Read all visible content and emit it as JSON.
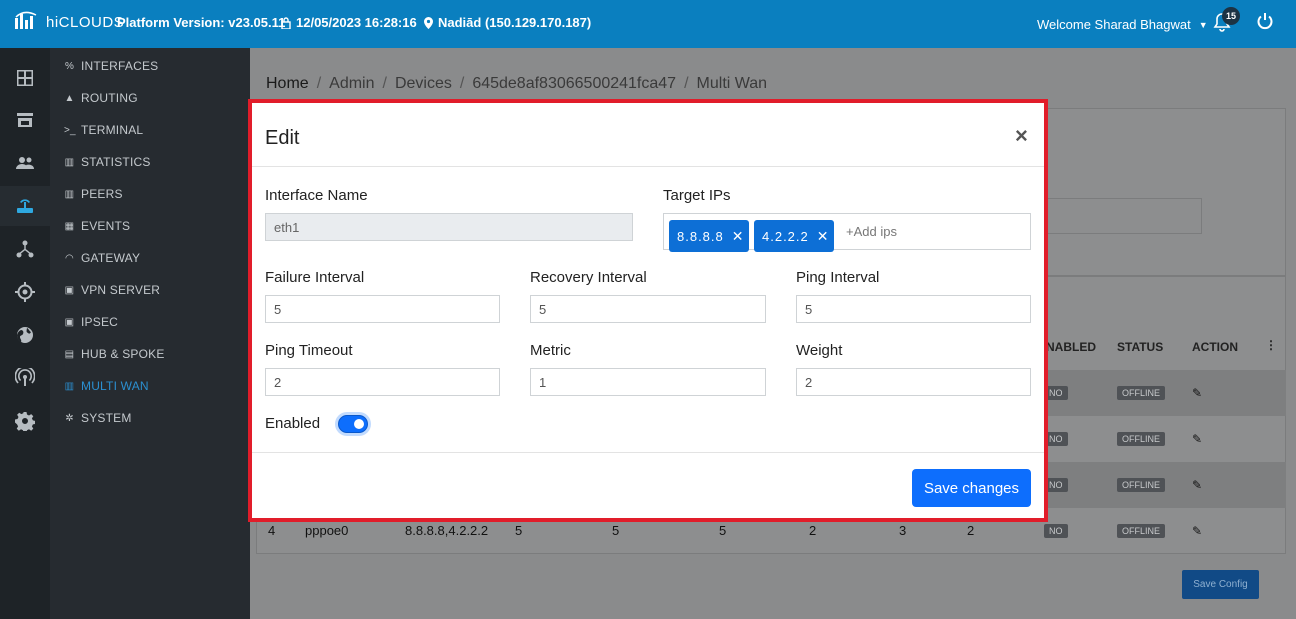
{
  "header": {
    "logo_text": "hiCLOUDS",
    "platform_version": "Platform Version: v23.05.11",
    "datetime": "12/05/2023 16:28:16",
    "location": "Nadiād (150.129.170.187)",
    "welcome": "Welcome Sharad Bhagwat",
    "notification_count": "15"
  },
  "rail_icons": [
    "grid-icon",
    "store-icon",
    "users-icon",
    "router-icon",
    "network-icon",
    "target-icon",
    "globe-icon",
    "signal-icon",
    "gear-icon"
  ],
  "submenu": {
    "items": [
      {
        "label": "INTERFACES",
        "icon": "link-icon"
      },
      {
        "label": "ROUTING",
        "icon": "routing-icon"
      },
      {
        "label": "TERMINAL",
        "icon": "terminal-icon"
      },
      {
        "label": "STATISTICS",
        "icon": "chart-icon"
      },
      {
        "label": "PEERS",
        "icon": "chart-icon"
      },
      {
        "label": "EVENTS",
        "icon": "calendar-icon"
      },
      {
        "label": "GATEWAY",
        "icon": "wifi-icon"
      },
      {
        "label": "VPN SERVER",
        "icon": "window-icon"
      },
      {
        "label": "IPSEC",
        "icon": "window-icon"
      },
      {
        "label": "HUB & SPOKE",
        "icon": "folder-icon"
      },
      {
        "label": "MULTI WAN",
        "icon": "multiwan-icon",
        "active": true
      },
      {
        "label": "SYSTEM",
        "icon": "gear-icon"
      }
    ]
  },
  "breadcrumb": {
    "home": "Home",
    "admin": "Admin",
    "devices": "Devices",
    "device_id": "645de8af83066500241fca47",
    "page": "Multi Wan"
  },
  "background_table": {
    "headers": [
      "NABLED",
      "STATUS",
      "ACTION"
    ],
    "enabled_badge": "NO",
    "status_badge": "OFFLINE",
    "last_row": [
      "4",
      "pppoe0",
      "8.8.8.8,4.2.2.2",
      "5",
      "5",
      "5",
      "2",
      "3",
      "2"
    ],
    "save_config": "Save Config"
  },
  "modal": {
    "title": "Edit",
    "interface_name_label": "Interface Name",
    "interface_name_value": "eth1",
    "target_ips_label": "Target IPs",
    "target_ips": [
      "8.8.8.8",
      "4.2.2.2"
    ],
    "add_ips_placeholder": "+Add ips",
    "failure_interval_label": "Failure Interval",
    "failure_interval_value": "5",
    "recovery_interval_label": "Recovery Interval",
    "recovery_interval_value": "5",
    "ping_interval_label": "Ping Interval",
    "ping_interval_value": "5",
    "ping_timeout_label": "Ping Timeout",
    "ping_timeout_value": "2",
    "metric_label": "Metric",
    "metric_value": "1",
    "weight_label": "Weight",
    "weight_value": "2",
    "enabled_label": "Enabled",
    "enabled": true,
    "save_label": "Save changes"
  },
  "colors": {
    "topbar": "#0a7fbf",
    "primary": "#0d6efd",
    "highlight_border": "#e11d2a"
  }
}
